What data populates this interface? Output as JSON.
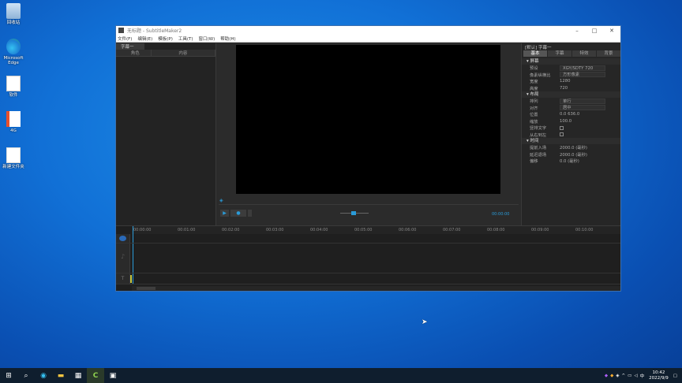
{
  "desktop": {
    "icons": [
      {
        "label": "回收站"
      },
      {
        "label": "Microsoft Edge"
      },
      {
        "label": "软件"
      },
      {
        "label": "4G"
      },
      {
        "label": "新建文件夹"
      }
    ]
  },
  "window": {
    "title": "无标题 - SubtitleMaker2",
    "menu": [
      "文件(F)",
      "编辑(E)",
      "模板(P)",
      "工具(T)",
      "窗口(W)",
      "帮助(H)"
    ],
    "left_panel": {
      "tab": "字幕一",
      "col_role": "角色",
      "col_content": "内容"
    },
    "right_panel": {
      "header": "[默认]  字幕一",
      "tabs": [
        "基本",
        "字幕",
        "特效",
        "背景"
      ],
      "sections": [
        {
          "title": "屏幕",
          "rows": [
            {
              "key": "预设",
              "value": "XGY/SDTY 720"
            },
            {
              "key": "像素纵横比",
              "value": "方形像素"
            },
            {
              "key": "宽度",
              "value": "1280"
            },
            {
              "key": "高度",
              "value": "720"
            }
          ]
        },
        {
          "title": "布局",
          "rows": [
            {
              "key": "排列",
              "value": "单行"
            },
            {
              "key": "对齐",
              "value": "居中"
            },
            {
              "key": "位置",
              "value": "0.0      636.0"
            },
            {
              "key": "缩放",
              "value": "100.0"
            },
            {
              "key": "竖排文字",
              "value": ""
            },
            {
              "key": "从右到左",
              "value": ""
            }
          ]
        },
        {
          "title": "时间",
          "rows": [
            {
              "key": "提前入场",
              "value": "2000.0 (毫秒)"
            },
            {
              "key": "延迟退场",
              "value": "2000.0 (毫秒)"
            },
            {
              "key": "偏移",
              "value": "0.0 (毫秒)"
            }
          ]
        }
      ]
    },
    "timecode": "00:00:00",
    "ruler": [
      "00:00:00",
      "00:01:00",
      "00:02:00",
      "00:03:00",
      "00:04:00",
      "00:05:00",
      "00:06:00",
      "00:07:00",
      "00:08:00",
      "00:09:00",
      "00:10:00"
    ]
  },
  "taskbar": {
    "time": "10:42",
    "date": "2022/9/9",
    "ime": "中"
  }
}
